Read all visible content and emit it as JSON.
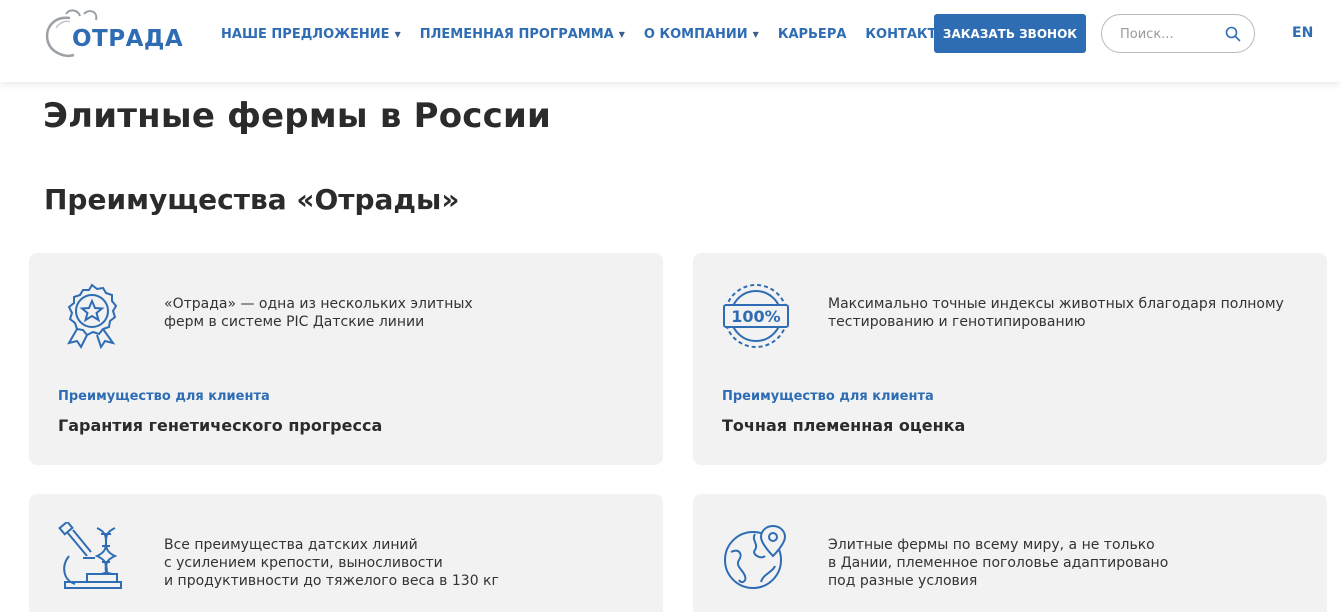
{
  "header": {
    "logo_text": "ОТРАДА",
    "nav": [
      {
        "label": "НАШЕ ПРЕДЛОЖЕНИЕ",
        "has_dropdown": true
      },
      {
        "label": "ПЛЕМЕННАЯ ПРОГРАММА",
        "has_dropdown": true
      },
      {
        "label": "О КОМПАНИИ",
        "has_dropdown": true
      },
      {
        "label": "КАРЬЕРА",
        "has_dropdown": false
      },
      {
        "label": "КОНТАКТЫ",
        "has_dropdown": false
      }
    ],
    "cta_label": "ЗАКАЗАТЬ ЗВОНОК",
    "search_placeholder": "Поиск...",
    "search_value": "",
    "lang": "EN"
  },
  "page_title": "Элитные фермы в России",
  "section_title": "Преимущества «Отрады»",
  "cards": [
    {
      "icon": "award-star-icon",
      "desc": "«Отрада» — одна из нескольких элитных\nферм в системе PIC Датские линии",
      "kicker": "Преимущество для клиента",
      "title": "Гарантия генетического прогресса"
    },
    {
      "icon": "hundred-percent-badge-icon",
      "desc": "Максимально точные индексы животных благодаря полному\nтестированию и генотипированию",
      "kicker": "Преимущество для клиента",
      "title": "Точная племенная оценка"
    },
    {
      "icon": "microscope-dna-icon",
      "desc": "Все преимущества датских линий\nс усилением крепости, выносливости\nи продуктивности до тяжелого веса в 130 кг",
      "kicker": "",
      "title": ""
    },
    {
      "icon": "globe-location-icon",
      "desc": "Элитные фермы по всему миру, а не только\nв Дании, племенное поголовье адаптировано\nпод разные условия",
      "kicker": "",
      "title": ""
    }
  ],
  "colors": {
    "brand_blue": "#2e6db4",
    "card_bg": "#f2f2f2",
    "text_dark": "#2b2b2b"
  }
}
